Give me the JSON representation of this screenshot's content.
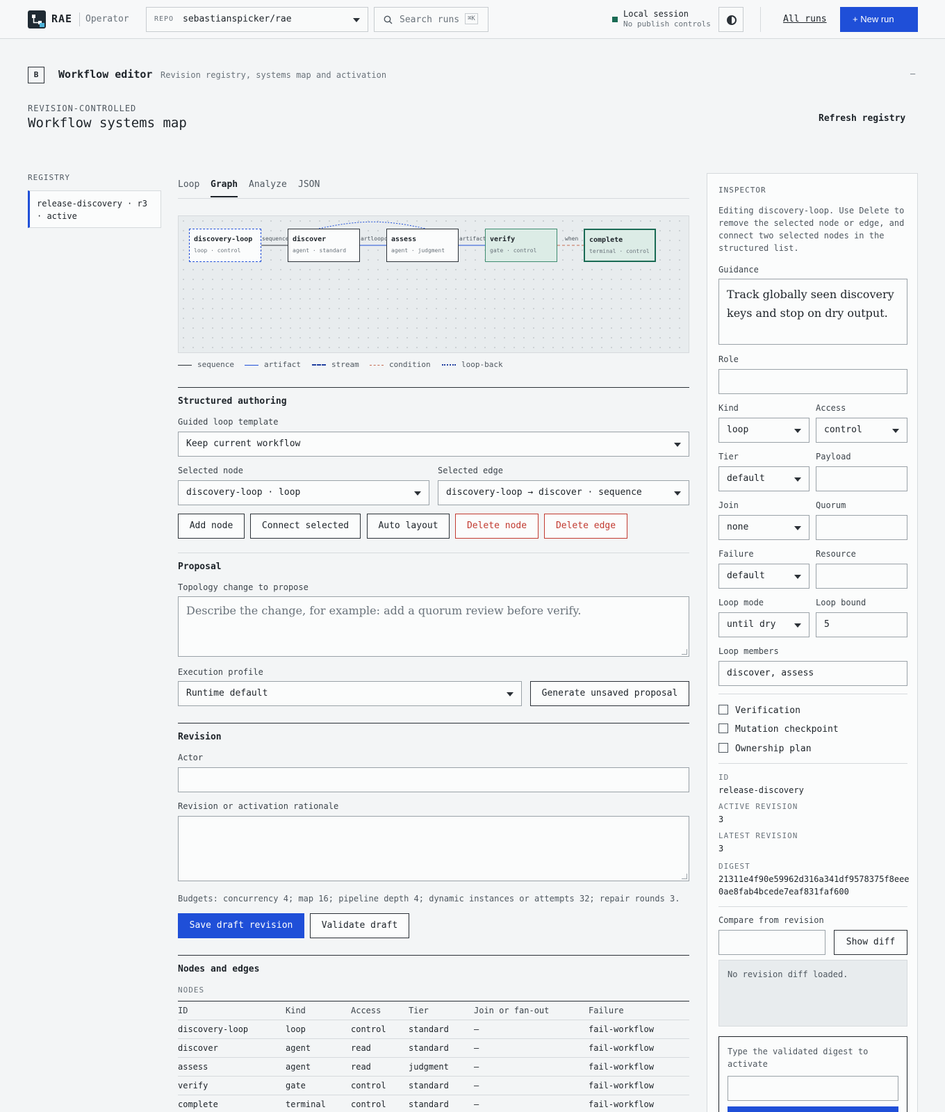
{
  "topbar": {
    "brand": "RAE",
    "brand_sub": "Operator",
    "repo_label": "REPO",
    "repo_value": "sebastianspicker/rae",
    "search_placeholder": "Search runs",
    "search_shortcut": "⌘K",
    "session_title": "Local session",
    "session_sub": "No publish controls",
    "all_runs": "All runs",
    "new_run": "+  New run"
  },
  "editor": {
    "badge": "B",
    "title": "Workflow editor",
    "subtitle": "Revision registry, systems map and activation",
    "minimize": "—",
    "eyebrow": "REVISION-CONTROLLED",
    "heading": "Workflow systems map",
    "refresh": "Refresh registry"
  },
  "registry": {
    "label": "REGISTRY",
    "items": [
      {
        "label": "release-discovery · r3 · active"
      }
    ]
  },
  "tabs": [
    "Loop",
    "Graph",
    "Analyze",
    "JSON"
  ],
  "active_tab": "Graph",
  "graph": {
    "nodes": [
      {
        "name": "discovery-loop",
        "meta": "loop · control"
      },
      {
        "name": "discover",
        "meta": "agent · standard"
      },
      {
        "name": "assess",
        "meta": "agent · judgment"
      },
      {
        "name": "verify",
        "meta": "gate · control"
      },
      {
        "name": "complete",
        "meta": "terminal · control"
      }
    ],
    "edge_labels": [
      "sequence",
      "artloopct",
      "artifact",
      "when"
    ],
    "legend": [
      "sequence",
      "artifact",
      "stream",
      "condition",
      "loop-back"
    ]
  },
  "structured": {
    "title": "Structured authoring",
    "template_label": "Guided loop template",
    "template_value": "Keep current workflow",
    "node_label": "Selected node",
    "node_value": "discovery-loop · loop",
    "edge_label": "Selected edge",
    "edge_value": "discovery-loop → discover · sequence",
    "buttons": {
      "add_node": "Add node",
      "connect": "Connect selected",
      "auto_layout": "Auto layout",
      "delete_node": "Delete node",
      "delete_edge": "Delete edge"
    }
  },
  "proposal": {
    "title": "Proposal",
    "topology_label": "Topology change to propose",
    "topology_placeholder": "Describe the change, for example: add a quorum review before verify.",
    "profile_label": "Execution profile",
    "profile_value": "Runtime default",
    "generate": "Generate unsaved proposal"
  },
  "revision": {
    "title": "Revision",
    "actor_label": "Actor",
    "rationale_label": "Revision or activation rationale",
    "budgets": "Budgets: concurrency 4; map 16; pipeline depth 4; dynamic instances or attempts 32; repair rounds 3.",
    "save": "Save draft revision",
    "validate": "Validate draft"
  },
  "table": {
    "title": "Nodes and edges",
    "nodes_label": "NODES",
    "headers": [
      "ID",
      "Kind",
      "Access",
      "Tier",
      "Join or fan-out",
      "Failure"
    ],
    "rows": [
      [
        "discovery-loop",
        "loop",
        "control",
        "standard",
        "—",
        "fail-workflow"
      ],
      [
        "discover",
        "agent",
        "read",
        "standard",
        "—",
        "fail-workflow"
      ],
      [
        "assess",
        "agent",
        "read",
        "judgment",
        "—",
        "fail-workflow"
      ],
      [
        "verify",
        "gate",
        "control",
        "standard",
        "—",
        "fail-workflow"
      ],
      [
        "complete",
        "terminal",
        "control",
        "standard",
        "—",
        "fail-workflow"
      ]
    ]
  },
  "inspector": {
    "title": "INSPECTOR",
    "intro": "Editing discovery-loop. Use Delete to remove the selected node or edge, and connect two selected nodes in the structured list.",
    "guidance_label": "Guidance",
    "guidance_value": "Track globally seen discovery keys and stop on dry output.",
    "role_label": "Role",
    "kind_label": "Kind",
    "kind_value": "loop",
    "access_label": "Access",
    "access_value": "control",
    "tier_label": "Tier",
    "tier_value": "default",
    "payload_label": "Payload",
    "join_label": "Join",
    "join_value": "none",
    "quorum_label": "Quorum",
    "failure_label": "Failure",
    "failure_value": "default",
    "resource_label": "Resource",
    "loop_mode_label": "Loop mode",
    "loop_mode_value": "until dry",
    "loop_bound_label": "Loop bound",
    "loop_bound_value": "5",
    "loop_members_label": "Loop members",
    "loop_members_value": "discover, assess",
    "checks": [
      "Verification",
      "Mutation checkpoint",
      "Ownership plan"
    ],
    "id_key": "ID",
    "id_value": "release-discovery",
    "active_key": "ACTIVE REVISION",
    "active_value": "3",
    "latest_key": "LATEST REVISION",
    "latest_value": "3",
    "digest_key": "DIGEST",
    "digest_value": "21311e4f90e59962d316a341df9578375f8eee0ae8fab4bcede7eaf831faf600",
    "compare_label": "Compare from revision",
    "show_diff": "Show diff",
    "diff_empty": "No revision diff loaded.",
    "activate_hint": "Type the validated digest to activate"
  },
  "colors": {
    "accent": "#1f4fd8",
    "danger": "#c23a30",
    "success": "#1a6b55"
  }
}
